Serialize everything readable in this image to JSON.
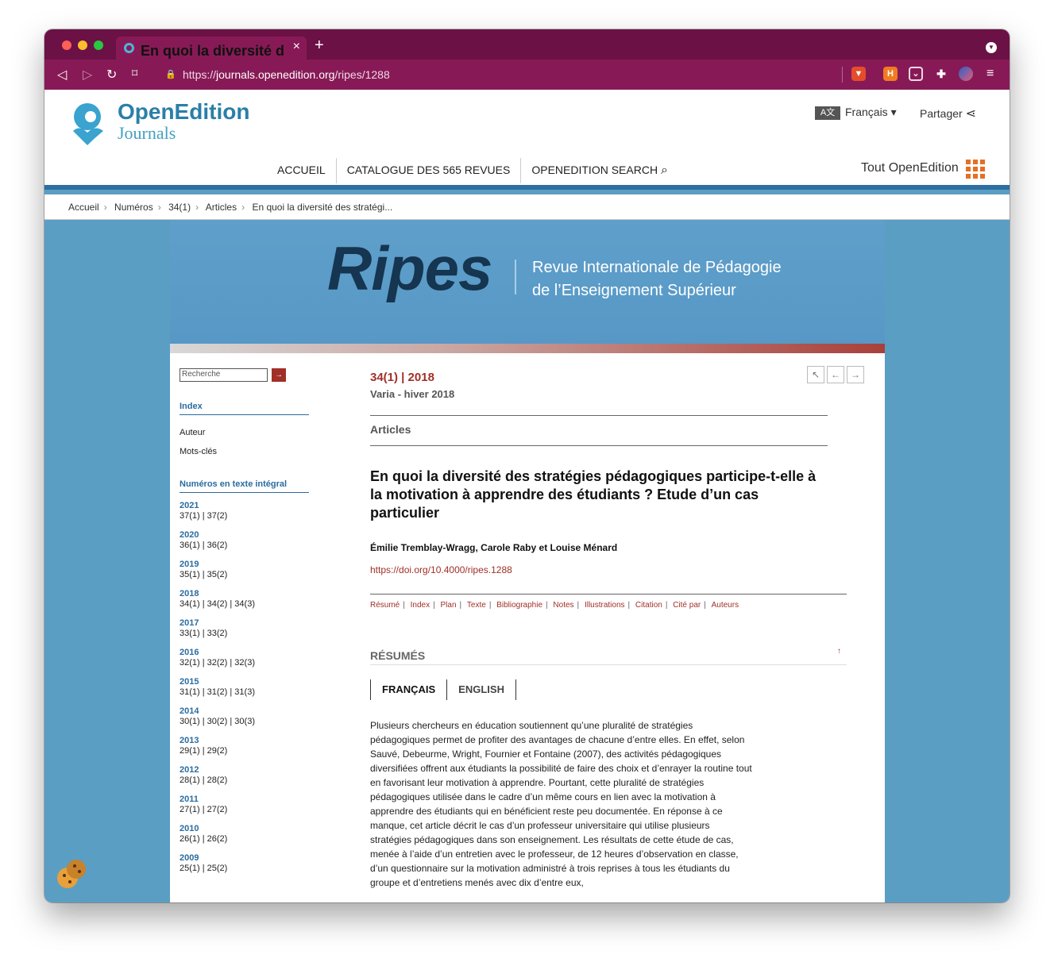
{
  "browser": {
    "tab_title": "En quoi la diversité des stratégi",
    "url_scheme": "https://",
    "url_host": "journals.openedition.org",
    "url_path": "/ripes/1288",
    "colors": {
      "titlebar": "#6b1145",
      "toolbar": "#871a56"
    }
  },
  "site": {
    "logo_line1": "OpenEdition",
    "logo_line2": "Journals",
    "language": "Français",
    "share": "Partager",
    "nav": [
      "ACCUEIL",
      "CATALOGUE DES 565 REVUES",
      "OPENEDITION SEARCH"
    ],
    "all_openedition": "Tout OpenEdition",
    "breadcrumb": [
      "Accueil",
      "Numéros",
      "34(1)",
      "Articles",
      "En quoi la diversité des stratégi..."
    ]
  },
  "journal": {
    "name": "Ripes",
    "subtitle_line1": "Revue Internationale de Pédagogie",
    "subtitle_line2": "de l’Enseignement Supérieur"
  },
  "sidebar": {
    "search_placeholder": "Recherche",
    "index_heading": "Index",
    "index_links": [
      "Auteur",
      "Mots-clés"
    ],
    "issues_heading": "Numéros en texte intégral",
    "years": [
      {
        "year": "2021",
        "issues": "37(1) | 37(2)"
      },
      {
        "year": "2020",
        "issues": "36(1) | 36(2)"
      },
      {
        "year": "2019",
        "issues": "35(1) | 35(2)"
      },
      {
        "year": "2018",
        "issues": "34(1) | 34(2) | 34(3)"
      },
      {
        "year": "2017",
        "issues": "33(1) | 33(2)"
      },
      {
        "year": "2016",
        "issues": "32(1) | 32(2) | 32(3)"
      },
      {
        "year": "2015",
        "issues": "31(1) | 31(2) | 31(3)"
      },
      {
        "year": "2014",
        "issues": "30(1) | 30(2) | 30(3)"
      },
      {
        "year": "2013",
        "issues": "29(1) | 29(2)"
      },
      {
        "year": "2012",
        "issues": "28(1) | 28(2)"
      },
      {
        "year": "2011",
        "issues": "27(1) | 27(2)"
      },
      {
        "year": "2010",
        "issues": "26(1) | 26(2)"
      },
      {
        "year": "2009",
        "issues": "25(1) | 25(2)"
      }
    ]
  },
  "article": {
    "issue": "34(1) | 2018",
    "issue_sub": "Varia - hiver 2018",
    "section": "Articles",
    "title": "En quoi la diversité des stratégies pédagogiques participe-t-elle à la motivation à apprendre des étudiants ? Etude d’un cas particulier",
    "authors": "Émilie Tremblay-Wragg, Carole Raby et Louise Ménard",
    "doi": "https://doi.org/10.4000/ripes.1288",
    "toc": [
      "Résumé",
      "Index",
      "Plan",
      "Texte",
      "Bibliographie",
      "Notes",
      "Illustrations",
      "Citation",
      "Cité par",
      "Auteurs"
    ],
    "resumes_heading": "RÉSUMÉS",
    "lang_tabs": [
      "FRANÇAIS",
      "ENGLISH"
    ],
    "abstract": "Plusieurs chercheurs en éducation soutiennent qu’une pluralité de stratégies pédagogiques permet de profiter des avantages de chacune d’entre elles. En effet, selon Sauvé, Debeurme, Wright, Fournier et Fontaine (2007), des activités pédagogiques diversifiées offrent aux étudiants la possibilité de faire des choix et d’enrayer la routine tout en favorisant leur motivation à apprendre. Pourtant, cette pluralité de stratégies pédagogiques utilisée dans le cadre d’un même cours en lien avec la motivation à apprendre des étudiants qui en bénéficient reste peu documentée. En réponse à ce manque, cet article décrit le cas d’un professeur universitaire qui utilise plusieurs stratégies pédagogiques dans son enseignement. Les résultats de cette étude de cas, menée à l’aide d’un entretien avec le professeur, de 12 heures d’observation en classe, d’un questionnaire sur la motivation administré à trois reprises à tous les étudiants du groupe et d’entretiens menés avec dix d’entre eux,"
  }
}
